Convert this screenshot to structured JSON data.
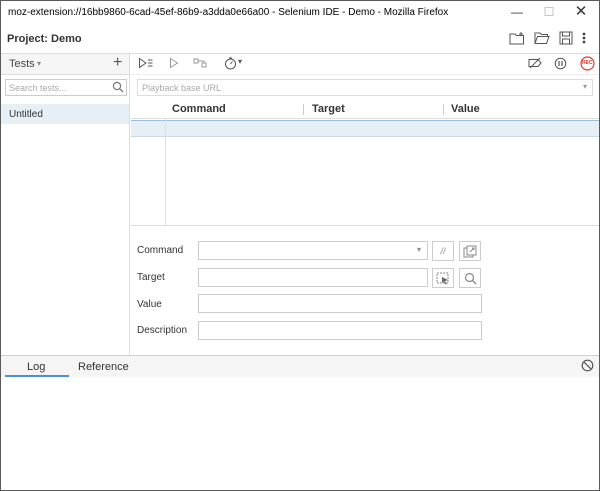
{
  "window": {
    "title": "moz-extension://16bb9860-6cad-45ef-86b9-a3dda0e66a00 - Selenium IDE - Demo - Mozilla Firefox",
    "minimize": "—",
    "maximize": "☐",
    "close": "✕"
  },
  "project": {
    "label": "Project:",
    "name": "Demo",
    "icons": [
      "new-project-icon",
      "open-project-icon",
      "save-project-icon",
      "more-icon"
    ]
  },
  "sidebar": {
    "header": "Tests",
    "caret": "▾",
    "add": "+",
    "search_placeholder": "Search tests...",
    "items": [
      {
        "label": "Untitled"
      }
    ]
  },
  "toolbar": {
    "icons": [
      "run-all-icon",
      "run-current-icon",
      "step-over-icon",
      "speed-icon",
      "disable-breakpoints-icon",
      "pause-on-exceptions-icon",
      "record-icon"
    ],
    "record_label": "REC",
    "speed_caret": "▾"
  },
  "url_bar": {
    "placeholder": "Playback base URL",
    "caret": "▾"
  },
  "table": {
    "columns": [
      "Command",
      "Target",
      "Value"
    ]
  },
  "editor": {
    "command_label": "Command",
    "target_label": "Target",
    "value_label": "Value",
    "description_label": "Description",
    "command_value": "",
    "target_value": "",
    "value_value": "",
    "description_value": "",
    "comment_toggle": "//",
    "dropdown_caret": "▾"
  },
  "bottom": {
    "tabs": [
      "Log",
      "Reference"
    ],
    "active_tab": "Log"
  },
  "colors": {
    "accent": "#4a90d9",
    "selection": "#e6eef6",
    "record": "#e03c31"
  }
}
